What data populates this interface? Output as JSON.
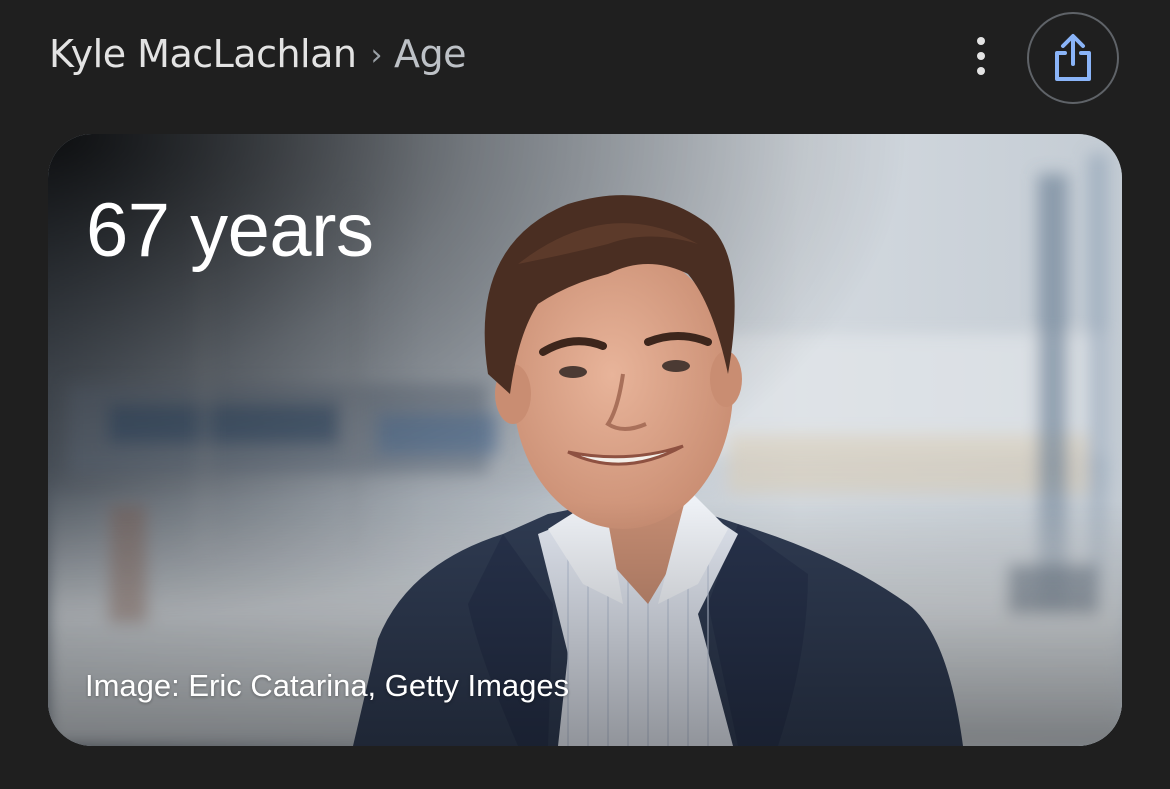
{
  "header": {
    "entity": "Kyle MacLachlan",
    "separator": "›",
    "attribute": "Age",
    "more_icon": "more-vert-icon",
    "share_icon": "share-icon"
  },
  "card": {
    "age": "67 years",
    "image_credit": "Image: Eric Catarina, Getty Images",
    "photo_description": "man-in-navy-blazer-at-marina"
  },
  "colors": {
    "background": "#1f1f1f",
    "share_icon": "#8ab4f8",
    "text_primary": "#e3e3e3",
    "text_secondary": "#bdc1c6"
  }
}
